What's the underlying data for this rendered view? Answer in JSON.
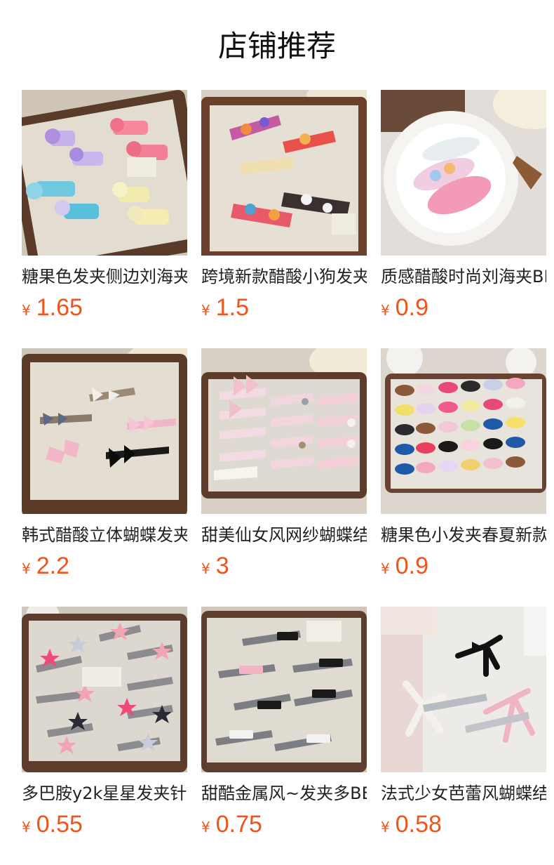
{
  "header": {
    "title": "店铺推荐"
  },
  "currency_symbol": "¥",
  "colors": {
    "price": "#f0541b",
    "title": "#111111",
    "name": "#222222"
  },
  "products": [
    {
      "name": "糖果色发夹侧边刘海夹",
      "price": "1.65",
      "image_icon": "hairclip-photo"
    },
    {
      "name": "跨境新款醋酸小狗发夹",
      "price": "1.5",
      "image_icon": "hairclip-photo"
    },
    {
      "name": "质感醋酸时尚刘海夹BB夹",
      "price": "0.9",
      "image_icon": "hairclip-photo"
    },
    {
      "name": "韩式醋酸立体蝴蝶发夹",
      "price": "2.2",
      "image_icon": "hairclip-photo"
    },
    {
      "name": "甜美仙女风网纱蝴蝶结",
      "price": "3",
      "image_icon": "hairclip-photo"
    },
    {
      "name": "糖果色小发夹春夏新款",
      "price": "0.9",
      "image_icon": "hairclip-photo"
    },
    {
      "name": "多巴胺y2k星星发夹针",
      "price": "0.55",
      "image_icon": "hairclip-photo"
    },
    {
      "name": "甜酷金属风~发夹多BB",
      "price": "0.75",
      "image_icon": "hairclip-photo"
    },
    {
      "name": "法式少女芭蕾风蝴蝶结",
      "price": "0.58",
      "image_icon": "hairclip-photo"
    }
  ]
}
